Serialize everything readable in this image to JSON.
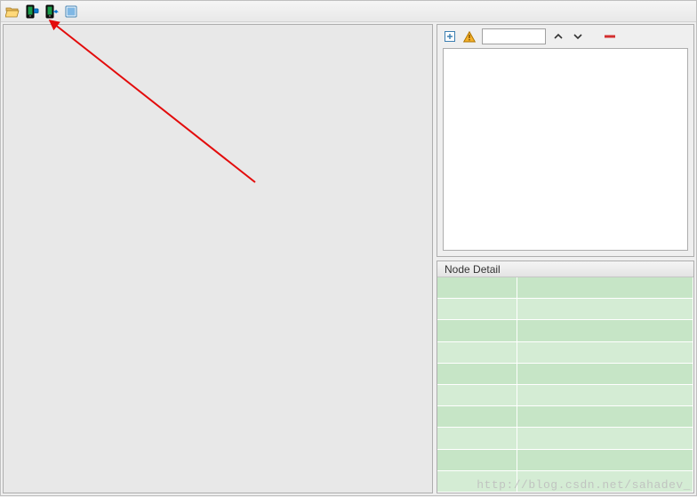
{
  "toolbar": {
    "buttons": [
      {
        "name": "open-file",
        "icon": "folder-open-icon"
      },
      {
        "name": "device-1",
        "icon": "device-icon"
      },
      {
        "name": "device-2",
        "icon": "device-arrow-icon"
      },
      {
        "name": "capture-screenshot",
        "icon": "screenshot-icon"
      }
    ]
  },
  "right_panel": {
    "toolbar": {
      "expand_label": "",
      "search_value": "",
      "search_placeholder": ""
    },
    "node_detail_header": "Node Detail",
    "detail_rows": [
      {
        "key": "",
        "value": ""
      },
      {
        "key": "",
        "value": ""
      },
      {
        "key": "",
        "value": ""
      },
      {
        "key": "",
        "value": ""
      },
      {
        "key": "",
        "value": ""
      },
      {
        "key": "",
        "value": ""
      },
      {
        "key": "",
        "value": ""
      },
      {
        "key": "",
        "value": ""
      },
      {
        "key": "",
        "value": ""
      },
      {
        "key": "",
        "value": ""
      }
    ]
  },
  "annotation": {
    "arrow_target": "device-2-toolbar-button"
  },
  "watermark": "http://blog.csdn.net/sahadev_"
}
